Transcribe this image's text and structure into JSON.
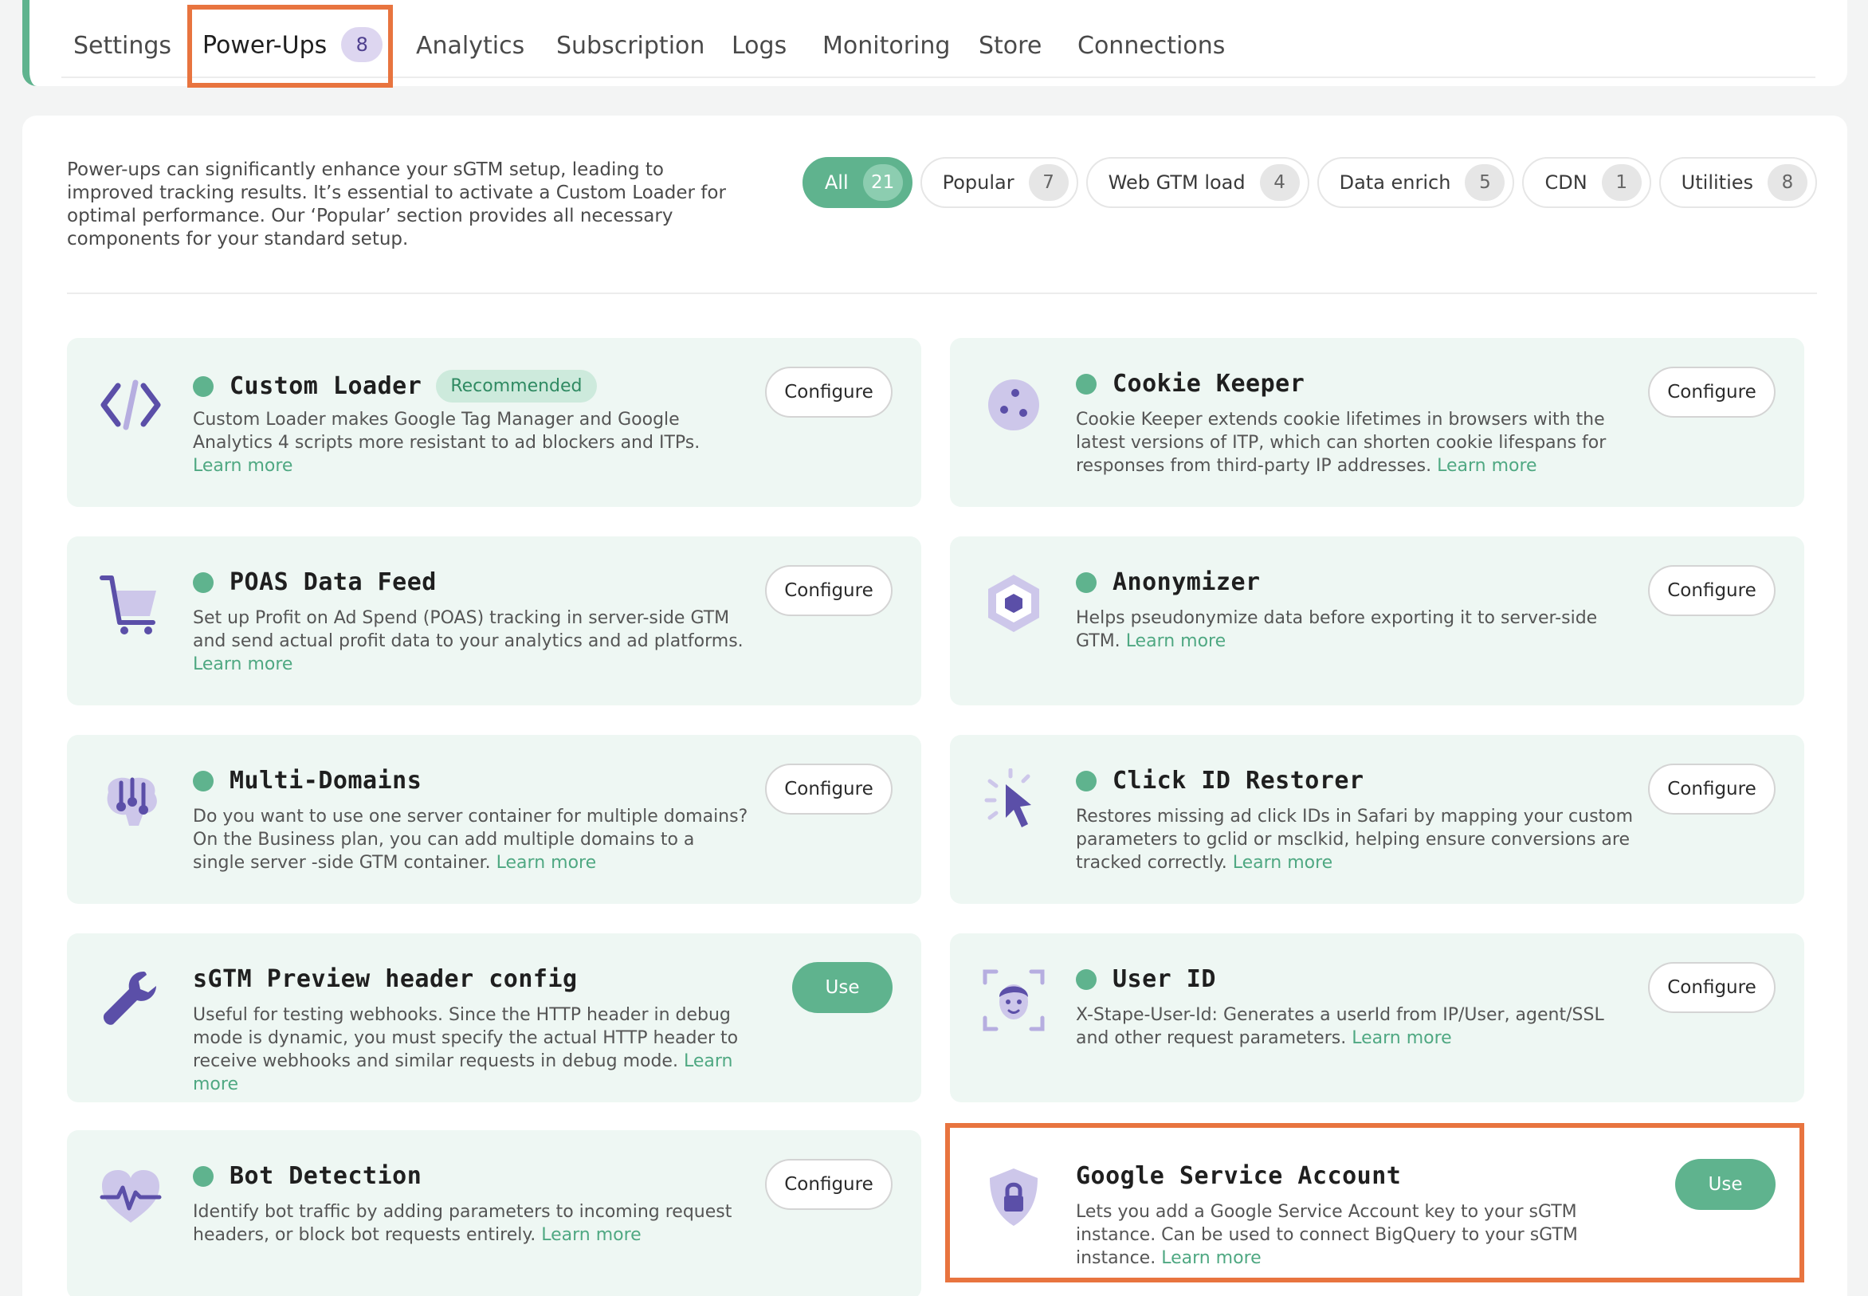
{
  "tabs": [
    {
      "label": "Settings"
    },
    {
      "label": "Power-Ups",
      "badge": "8"
    },
    {
      "label": "Analytics"
    },
    {
      "label": "Subscription"
    },
    {
      "label": "Logs"
    },
    {
      "label": "Monitoring"
    },
    {
      "label": "Store"
    },
    {
      "label": "Connections"
    }
  ],
  "intro": "Power-ups can significantly enhance your sGTM setup, leading to improved tracking results. It’s essential to activate a Custom Loader for optimal performance. Our ‘Popular’ section provides all necessary components for your standard setup.",
  "filters": [
    {
      "label": "All",
      "count": "21"
    },
    {
      "label": "Popular",
      "count": "7"
    },
    {
      "label": "Web GTM load",
      "count": "4"
    },
    {
      "label": "Data enrich",
      "count": "5"
    },
    {
      "label": "CDN",
      "count": "1"
    },
    {
      "label": "Utilities",
      "count": "8"
    }
  ],
  "cards": [
    {
      "title": "Custom Loader",
      "tag": "Recommended",
      "desc": "Custom Loader makes Google Tag Manager and Google Analytics 4 scripts more resistant to ad blockers and ITPs.",
      "link": "Learn more",
      "button": "Configure",
      "icon": "code-icon"
    },
    {
      "title": "Cookie Keeper",
      "desc": "Cookie Keeper extends cookie lifetimes in browsers with the latest versions of ITP, which can shorten cookie lifespans for responses from third-party IP addresses.",
      "link": "Learn more",
      "button": "Configure",
      "icon": "cookie-icon"
    },
    {
      "title": "POAS Data Feed",
      "desc": "Set up Profit on Ad Spend (POAS) tracking in server-side GTM and send actual profit data to your analytics and ad platforms.",
      "link": "Learn more",
      "button": "Configure",
      "icon": "cart-icon"
    },
    {
      "title": "Anonymizer",
      "desc": "Helps pseudonymize data before exporting it to server-side GTM.",
      "link": "Learn more",
      "button": "Configure",
      "icon": "hexagon-icon"
    },
    {
      "title": "Multi-Domains",
      "desc": "Do you want to use one server container for multiple domains? On the Business plan, you can add multiple domains to a single server -side GTM container.",
      "link": "Learn more",
      "button": "Configure",
      "icon": "brain-network-icon"
    },
    {
      "title": "Click ID Restorer",
      "desc": "Restores missing ad click IDs in Safari by mapping your custom parameters to gclid or msclkid, helping ensure conversions are tracked correctly.",
      "link": "Learn more",
      "button": "Configure",
      "icon": "cursor-click-icon"
    },
    {
      "title": "sGTM Preview header config",
      "desc": "Useful for testing webhooks. Since the HTTP header in debug mode is dynamic, you must specify the actual HTTP header to receive webhooks and similar requests in debug mode.",
      "link": "Learn more",
      "button": "Use",
      "icon": "wrench-icon"
    },
    {
      "title": "User ID",
      "desc": "X-Stape-User-Id: Generates a userId from IP/User, agent/SSL and other request parameters.",
      "link": "Learn more",
      "button": "Configure",
      "icon": "face-scan-icon"
    },
    {
      "title": "Bot Detection",
      "desc": "Identify bot traffic by adding parameters to incoming request headers, or block bot requests entirely.",
      "link": "Learn more",
      "button": "Configure",
      "icon": "heart-pulse-icon"
    },
    {
      "title": "Google Service Account",
      "desc": "Lets you add a Google Service Account key to your sGTM instance. Can be used to connect BigQuery to your sGTM instance.",
      "link": "Learn more",
      "button": "Use",
      "icon": "shield-lock-icon"
    }
  ],
  "colors": {
    "accent": "#5fb38e",
    "highlight": "#e8743f",
    "icon": "#5b4fa8"
  }
}
